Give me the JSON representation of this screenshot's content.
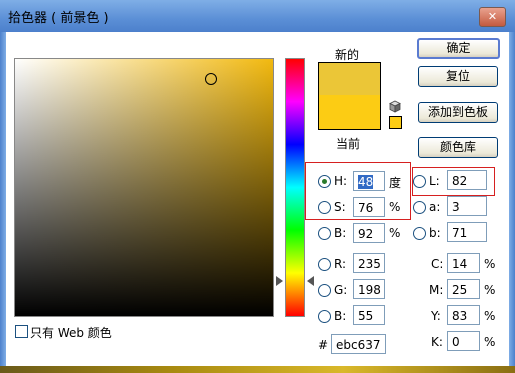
{
  "window": {
    "title": "拾色器 ( 前景色 )",
    "close_icon": "close-icon"
  },
  "labels": {
    "new": "新的",
    "current": "当前"
  },
  "colors": {
    "new_swatch": "#ebc637",
    "current_swatch": "#fccc14",
    "web_swatch": "#fccc14"
  },
  "buttons": {
    "ok": "确定",
    "reset": "复位",
    "add_swatch": "添加到色板",
    "library": "颜色库"
  },
  "hsb": {
    "h": {
      "label": "H:",
      "value": "48",
      "unit": "度"
    },
    "s": {
      "label": "S:",
      "value": "76",
      "unit": "%"
    },
    "b": {
      "label": "B:",
      "value": "92",
      "unit": "%"
    }
  },
  "rgb": {
    "r": {
      "label": "R:",
      "value": "235"
    },
    "g": {
      "label": "G:",
      "value": "198"
    },
    "b": {
      "label": "B:",
      "value": "55"
    }
  },
  "lab": {
    "l": {
      "label": "L:",
      "value": "82"
    },
    "a": {
      "label": "a:",
      "value": "3"
    },
    "b": {
      "label": "b:",
      "value": "71"
    }
  },
  "cmyk": {
    "c": {
      "label": "C:",
      "value": "14",
      "unit": "%"
    },
    "m": {
      "label": "M:",
      "value": "25",
      "unit": "%"
    },
    "y": {
      "label": "Y:",
      "value": "83",
      "unit": "%"
    },
    "k": {
      "label": "K:",
      "value": "0",
      "unit": "%"
    }
  },
  "hex": {
    "label": "#",
    "value": "ebc637"
  },
  "web_only": {
    "label": "只有 Web 颜色"
  }
}
